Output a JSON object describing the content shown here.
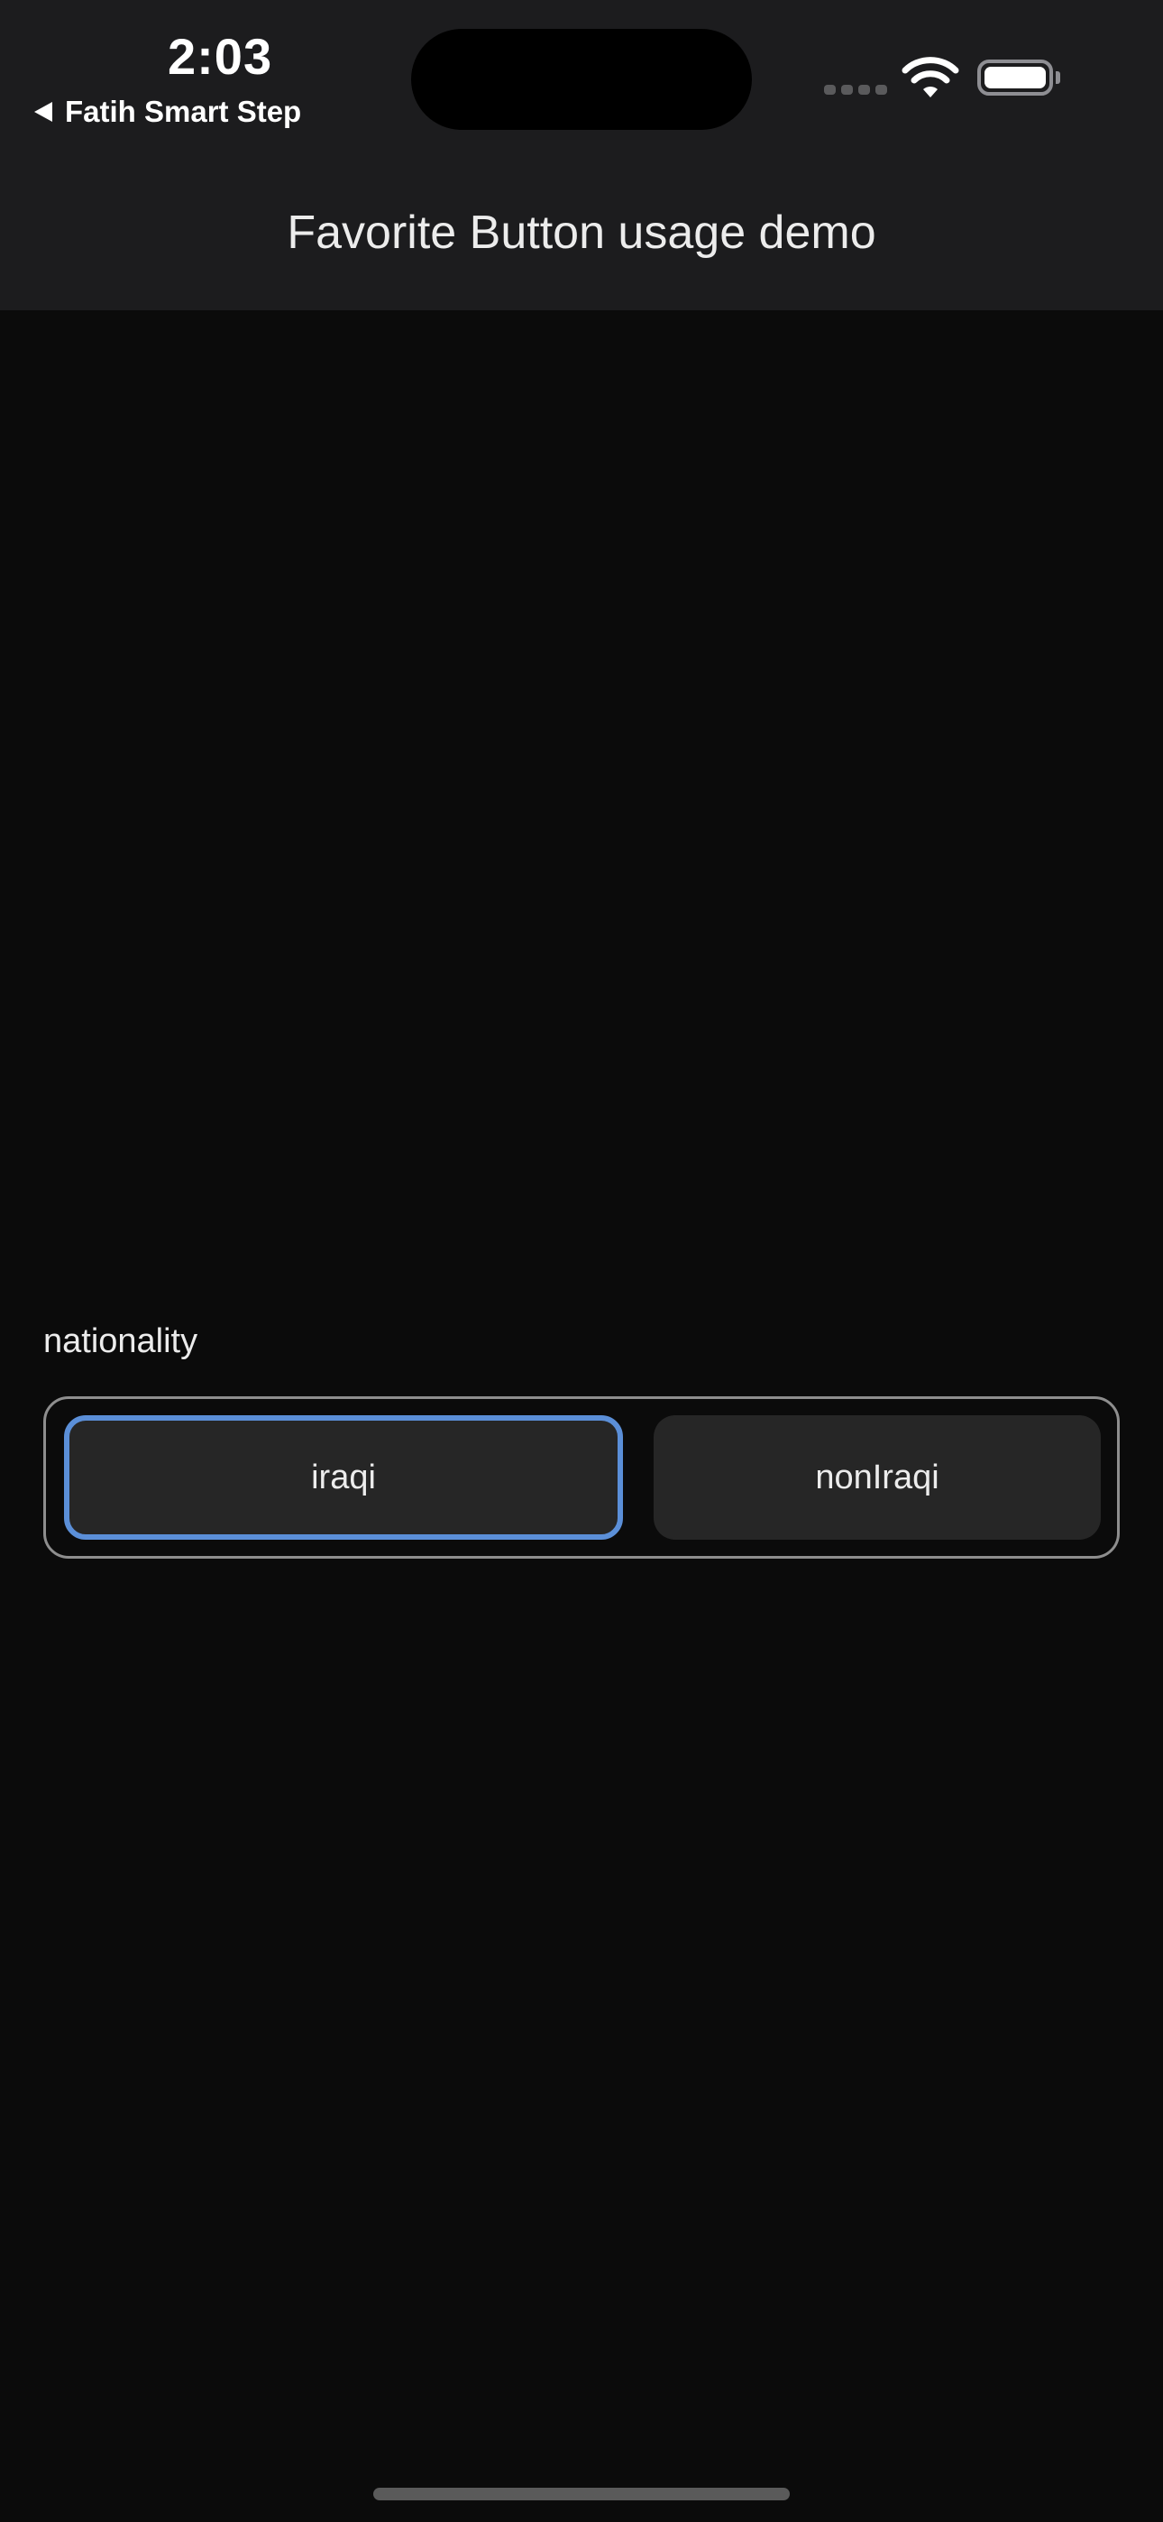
{
  "status_bar": {
    "time": "2:03",
    "back_app": "Fatih Smart Step",
    "icons": [
      "cellular-signal-icon",
      "wifi-icon",
      "battery-icon"
    ]
  },
  "nav": {
    "title": "Favorite Button usage demo"
  },
  "form": {
    "label": "nationality",
    "options": [
      {
        "label": "iraqi",
        "selected": true
      },
      {
        "label": "nonIraqi",
        "selected": false
      }
    ],
    "accent_color": "#5b8fd8"
  },
  "colors": {
    "background": "#0b0b0b",
    "header": "#1c1c1e",
    "segment": "#262626"
  }
}
